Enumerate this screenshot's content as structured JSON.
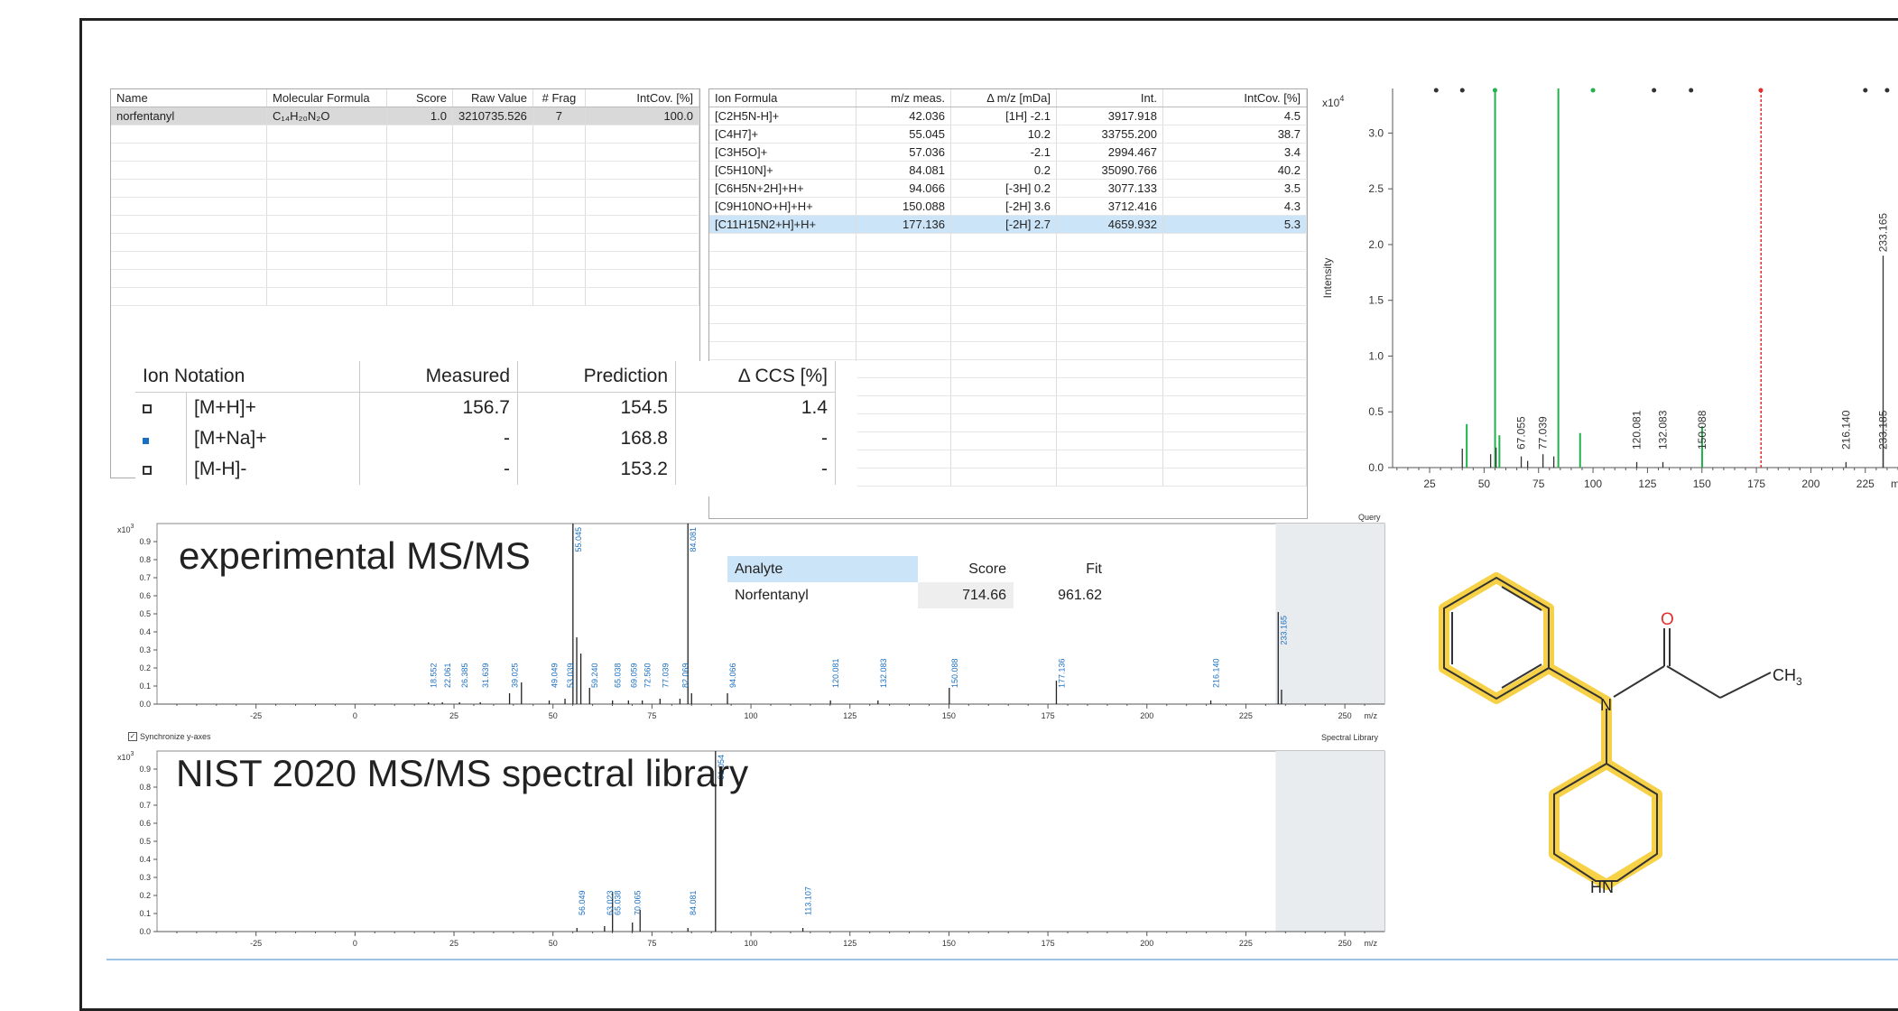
{
  "compound_table": {
    "headers": [
      "Name",
      "Molecular Formula",
      "Score",
      "Raw Value",
      "# Frag",
      "IntCov. [%]"
    ],
    "rows": [
      [
        "norfentanyl",
        "C₁₄H₂₀N₂O",
        "1.0",
        "3210735.526",
        "7",
        "100.0"
      ]
    ]
  },
  "fragment_table": {
    "headers": [
      "Ion Formula",
      "m/z meas.",
      "Δ m/z [mDa]",
      "Int.",
      "IntCov. [%]"
    ],
    "rows": [
      [
        "[C2H5N-H]+",
        "42.036",
        "[1H] -2.1",
        "3917.918",
        "4.5"
      ],
      [
        "[C4H7]+",
        "55.045",
        "10.2",
        "33755.200",
        "38.7"
      ],
      [
        "[C3H5O]+",
        "57.036",
        "-2.1",
        "2994.467",
        "3.4"
      ],
      [
        "[C5H10N]+",
        "84.081",
        "0.2",
        "35090.766",
        "40.2"
      ],
      [
        "[C6H5N+2H]+H+",
        "94.066",
        "[-3H] 0.2",
        "3077.133",
        "3.5"
      ],
      [
        "[C9H10NO+H]+H+",
        "150.088",
        "[-2H] 3.6",
        "3712.416",
        "4.3"
      ],
      [
        "[C11H15N2+H]+H+",
        "177.136",
        "[-2H] 2.7",
        "4659.932",
        "5.3"
      ]
    ]
  },
  "ccs_table": {
    "headers": [
      "Ion Notation",
      "Measured",
      "Prediction",
      "Δ CCS [%]"
    ],
    "rows": [
      {
        "ion": "[M+H]+",
        "measured": "156.7",
        "prediction": "154.5",
        "delta": "1.4",
        "marker": "open-square"
      },
      {
        "ion": "[M+Na]+",
        "measured": "-",
        "prediction": "168.8",
        "delta": "-",
        "marker": "filled-square"
      },
      {
        "ion": "[M-H]-",
        "measured": "-",
        "prediction": "153.2",
        "delta": "-",
        "marker": "open-square"
      }
    ]
  },
  "experimental_label": "experimental MS/MS",
  "library_label": "NIST 2020 MS/MS spectral library",
  "query_label": "Query",
  "spectral_library_label": "Spectral Library",
  "sync_label": "Synchronize y-axes",
  "analyte_table": {
    "headers": [
      "Analyte",
      "Score",
      "Fit"
    ],
    "rows": [
      [
        "Norfentanyl",
        "714.66",
        "961.62"
      ]
    ]
  },
  "structure_labels": {
    "oxygen": "O",
    "nitrogen": "N",
    "methyl": "CH",
    "methyl_sub": "3",
    "amine": "HN"
  },
  "colors": {
    "green": "#22b14c",
    "red": "#e03030",
    "blue": "#1a6fc0",
    "highlight": "#f5c518"
  },
  "chart_data": [
    {
      "type": "bar",
      "name": "right-spectrum",
      "ylabel": "Intensity",
      "yexp": "x10",
      "yexp_power": "4",
      "xlabel": "m/",
      "xlim": [
        8,
        240
      ],
      "ylim": [
        0,
        3.4
      ],
      "yticks": [
        "0.0",
        "0.5",
        "1.0",
        "1.5",
        "2.0",
        "2.5",
        "3.0"
      ],
      "xticks": [
        "25",
        "50",
        "75",
        "100",
        "125",
        "150",
        "175",
        "200",
        "225"
      ],
      "series": [
        {
          "color": "green",
          "points": [
            [
              55.045,
              3.38
            ],
            [
              84.081,
              3.51
            ],
            [
              94.066,
              0.31
            ],
            [
              150.088,
              0.37
            ],
            [
              57.036,
              0.29
            ],
            [
              42.036,
              0.39
            ]
          ]
        },
        {
          "color": "red",
          "points": [
            [
              177.136,
              3.4
            ]
          ]
        },
        {
          "color": "black",
          "points": [
            [
              40,
              0.17
            ],
            [
              53,
              0.12
            ],
            [
              55.5,
              0.18
            ],
            [
              67.055,
              0.1
            ],
            [
              70,
              0.06
            ],
            [
              77.039,
              0.12
            ],
            [
              82,
              0.1
            ],
            [
              120.081,
              0.05
            ],
            [
              132.083,
              0.05
            ],
            [
              216.14,
              0.05
            ],
            [
              233.165,
              1.9
            ],
            [
              233.185,
              0.5
            ]
          ]
        }
      ],
      "labels": [
        {
          "x": 67.055,
          "text": "67.055",
          "color": "black"
        },
        {
          "x": 77.039,
          "text": "77.039",
          "color": "black"
        },
        {
          "x": 120.081,
          "text": "120.081",
          "color": "black"
        },
        {
          "x": 132.083,
          "text": "132.083",
          "color": "black"
        },
        {
          "x": 150.088,
          "text": "150.088",
          "color": "black"
        },
        {
          "x": 216.14,
          "text": "216.140",
          "color": "black"
        },
        {
          "x": 233.185,
          "text": "233.185",
          "color": "black"
        },
        {
          "x": 233.165,
          "text": "233.165",
          "color": "black",
          "y": 1.9
        }
      ]
    },
    {
      "type": "bar",
      "name": "experimental-spectrum",
      "yexp": "x10",
      "yexp_power": "3",
      "xlabel": "m/z",
      "xlim": [
        -50,
        260
      ],
      "ylim": [
        0,
        1.0
      ],
      "yticks": [
        "0.0",
        "0.1",
        "0.2",
        "0.3",
        "0.4",
        "0.5",
        "0.6",
        "0.7",
        "0.8",
        "0.9"
      ],
      "xticks": [
        "-25",
        "0",
        "25",
        "50",
        "75",
        "100",
        "125",
        "150",
        "175",
        "200",
        "225",
        "250"
      ],
      "shade_from": 232.5,
      "peaks": [
        [
          18.552,
          0.01
        ],
        [
          22.061,
          0.01
        ],
        [
          26.385,
          0.01
        ],
        [
          31.639,
          0.01
        ],
        [
          39.025,
          0.06
        ],
        [
          42.036,
          0.12
        ],
        [
          49.049,
          0.02
        ],
        [
          53.039,
          0.03
        ],
        [
          55.045,
          1.0
        ],
        [
          56,
          0.37
        ],
        [
          57.036,
          0.28
        ],
        [
          59.24,
          0.09
        ],
        [
          65.038,
          0.02
        ],
        [
          69.059,
          0.02
        ],
        [
          72.56,
          0.02
        ],
        [
          77.039,
          0.03
        ],
        [
          82.069,
          0.03
        ],
        [
          84.081,
          1.0
        ],
        [
          85,
          0.06
        ],
        [
          94.066,
          0.06
        ],
        [
          120.081,
          0.02
        ],
        [
          132.083,
          0.02
        ],
        [
          150.088,
          0.09
        ],
        [
          177.136,
          0.13
        ],
        [
          216.14,
          0.02
        ],
        [
          233.165,
          0.51
        ],
        [
          234,
          0.08
        ]
      ],
      "labels": [
        [
          "18.552",
          18.552,
          null
        ],
        [
          "22.061",
          22.061,
          null
        ],
        [
          "26.385",
          26.385,
          null
        ],
        [
          "31.639",
          31.639,
          null
        ],
        [
          "39.025",
          39.025,
          null
        ],
        [
          "49.049",
          49.049,
          null
        ],
        [
          "53.039",
          53.039,
          null
        ],
        [
          "55.045",
          55.045,
          1.0
        ],
        [
          "59.240",
          59.24,
          null
        ],
        [
          "65.038",
          65.038,
          null
        ],
        [
          "69.059",
          69.059,
          null
        ],
        [
          "72.560",
          72.56,
          null
        ],
        [
          "77.039",
          77.039,
          null
        ],
        [
          "82.069",
          82.069,
          null
        ],
        [
          "84.081",
          84.081,
          1.0
        ],
        [
          "94.066",
          94.066,
          null
        ],
        [
          "120.081",
          120.081,
          null
        ],
        [
          "132.083",
          132.083,
          null
        ],
        [
          "150.088",
          150.088,
          null
        ],
        [
          "177.136",
          177.136,
          null
        ],
        [
          "216.140",
          216.14,
          null
        ],
        [
          "233.165",
          233.165,
          0.51
        ]
      ]
    },
    {
      "type": "bar",
      "name": "library-spectrum",
      "yexp": "x10",
      "yexp_power": "3",
      "xlabel": "m/z",
      "xlim": [
        -50,
        260
      ],
      "ylim": [
        0,
        1.0
      ],
      "yticks": [
        "0.0",
        "0.1",
        "0.2",
        "0.3",
        "0.4",
        "0.5",
        "0.6",
        "0.7",
        "0.8",
        "0.9"
      ],
      "xticks": [
        "-25",
        "0",
        "25",
        "50",
        "75",
        "100",
        "125",
        "150",
        "175",
        "200",
        "225",
        "250"
      ],
      "shade_from": 232.5,
      "peaks": [
        [
          56.049,
          0.02
        ],
        [
          63.023,
          0.03
        ],
        [
          65.038,
          0.22
        ],
        [
          70.065,
          0.05
        ],
        [
          72,
          0.12
        ],
        [
          84.081,
          0.02
        ],
        [
          91.054,
          1.0
        ],
        [
          113.107,
          0.02
        ]
      ],
      "labels": [
        [
          "56.049",
          56.049,
          null
        ],
        [
          "63.023",
          63.023,
          null
        ],
        [
          "65.038",
          65.038,
          null
        ],
        [
          "70.065",
          70.065,
          null
        ],
        [
          "84.081",
          84.081,
          null
        ],
        [
          "91.054",
          91.054,
          1.0
        ],
        [
          "113.107",
          113.107,
          null
        ]
      ]
    }
  ]
}
